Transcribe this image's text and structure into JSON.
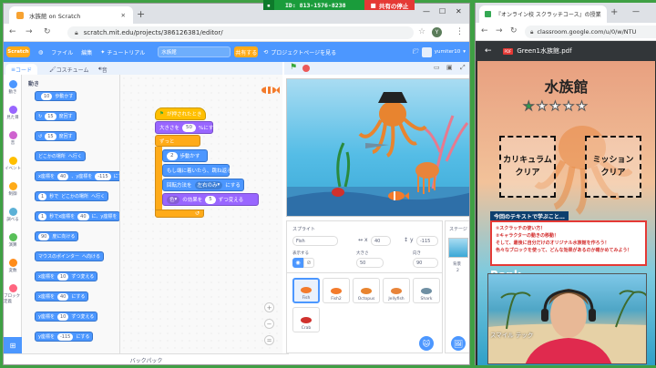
{
  "meeting_bar": {
    "meeting_id": "ID: 813-1576-8238",
    "stop_share": "共有の停止"
  },
  "left_browser": {
    "tab_title": "水族館 on Scratch",
    "url": "scratch.mit.edu/projects/386126381/editor/"
  },
  "scratch": {
    "logo": "Scratch",
    "menu": {
      "file": "ファイル",
      "edit": "編集",
      "tutorial": "チュートリアル",
      "project_name": "水族館",
      "share": "共有する",
      "see_project_page": "プロジェクトページを見る",
      "username": "yumiter10"
    },
    "tabs": {
      "code": "コード",
      "costumes": "コスチューム",
      "sounds": "音"
    },
    "categories": [
      {
        "label": "動き",
        "color": "#4c97ff"
      },
      {
        "label": "見た目",
        "color": "#9966ff"
      },
      {
        "label": "音",
        "color": "#cf63cf"
      },
      {
        "label": "イベント",
        "color": "#ffbf00"
      },
      {
        "label": "制御",
        "color": "#ffab19"
      },
      {
        "label": "調べる",
        "color": "#5cb1d6"
      },
      {
        "label": "演算",
        "color": "#59c059"
      },
      {
        "label": "変数",
        "color": "#ff8c1a"
      },
      {
        "label": "ブロック定義",
        "color": "#ff6680"
      }
    ],
    "palette": {
      "header": "動き",
      "blocks": [
        {
          "parts": [
            "",
            "10",
            "歩動かす"
          ]
        },
        {
          "parts": [
            "↻",
            "15",
            "度回す"
          ]
        },
        {
          "parts": [
            "↺",
            "15",
            "度回す"
          ]
        },
        {
          "parts": [
            "どこかの場所",
            "へ行く"
          ]
        },
        {
          "parts": [
            "x座標を",
            "40",
            "、y座標を",
            "-115",
            "にする"
          ]
        },
        {
          "parts": [
            "1",
            "秒で",
            "どこかの場所",
            "へ行く"
          ]
        },
        {
          "parts": [
            "1",
            "秒でx座標を",
            "40",
            "に、y座標を"
          ]
        },
        {
          "parts": [
            "90",
            "度に向ける"
          ]
        },
        {
          "parts": [
            "マウスのポインター",
            "へ向ける"
          ]
        },
        {
          "parts": [
            "x座標を",
            "10",
            "ずつ変える"
          ]
        },
        {
          "parts": [
            "x座標を",
            "40",
            "にする"
          ]
        },
        {
          "parts": [
            "y座標を",
            "10",
            "ずつ変える"
          ]
        },
        {
          "parts": [
            "y座標を",
            "-115",
            "にする"
          ]
        }
      ]
    },
    "script": {
      "when_flag": "が押されたとき",
      "set_size_pre": "大きさを",
      "set_size_val": "50",
      "set_size_post": "%にする",
      "forever": "ずっと",
      "move_val": "2",
      "move_post": "歩動かす",
      "bounce": "もし端に着いたら、跳ね返る",
      "rotation_pre": "回転方法を",
      "rotation_val": "左右のみ",
      "rotation_post": "にする",
      "effect_val": "色",
      "effect_mid": "の効果を",
      "effect_num": "5",
      "effect_post": "ずつ変える"
    },
    "backpack": "バックパック",
    "sprite_info": {
      "sprite_label": "スプライト",
      "sprite_name": "Fish",
      "x_label": "x",
      "x_value": "40",
      "y_label": "y",
      "y_value": "-115",
      "show_label": "表示する",
      "size_label": "大きさ",
      "size_value": "50",
      "direction_label": "向き",
      "direction_value": "90"
    },
    "sprites": [
      "Fish",
      "Fish2",
      "Octopus",
      "Jellyfish",
      "Shark",
      "Crab"
    ],
    "stage_panel": {
      "label": "ステージ",
      "backdrop_label": "背景",
      "backdrop_count": "2"
    }
  },
  "right_browser": {
    "tab_title": "『オンライン校 スクラッチコース』の授業",
    "url": "classroom.google.com/u/0/w/NTU",
    "pdf_name": "Green1水族館.pdf",
    "pdf_badge": "PDF"
  },
  "pdf": {
    "title": "水族館",
    "stars_filled": 1,
    "stars_total": 5,
    "box1_line1": "カリキュラム",
    "box1_line2": "クリア",
    "box2_line1": "ミッション",
    "box2_line2": "クリア",
    "info_title": "今回のテキストで学ぶこと…",
    "info_line1": "①スクラッチの使い方！",
    "info_line2": "②キャラクターの動きの移動！",
    "info_line3": "そして、最後に自分だけのオリジナル水族館を作ろう！",
    "info_line4": "色々なブロックを使って、どんな効果があるのか確かめてみよう！",
    "partial_text": "Rank"
  },
  "webcam": {
    "label": "スマイル テック"
  }
}
